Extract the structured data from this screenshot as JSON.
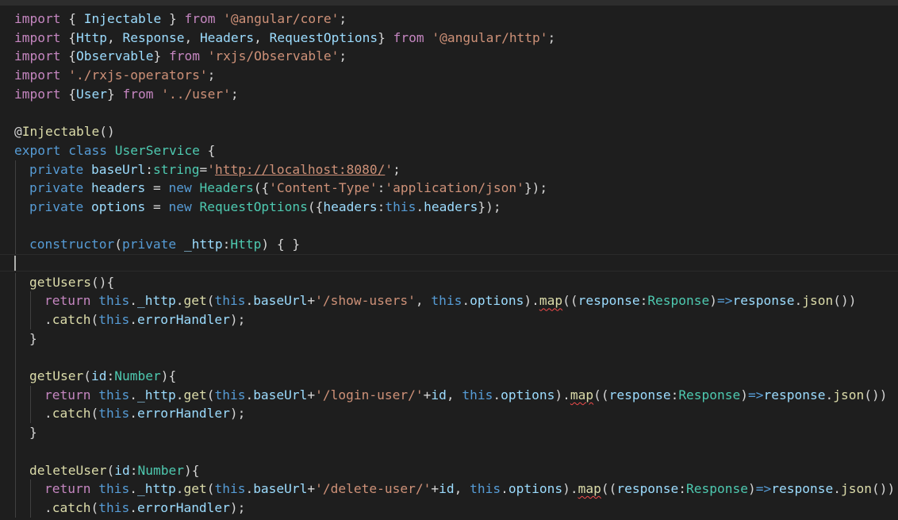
{
  "editor": {
    "language": "typescript",
    "theme_colors": {
      "background": "#1e1e1e",
      "keyword": "#569cd6",
      "control": "#c586c0",
      "type": "#4ec9b0",
      "string": "#ce9178",
      "variable": "#9cdcfe",
      "function": "#dcdcaa",
      "plain": "#d4d4d4",
      "error_squiggle": "#f14c4c"
    },
    "cursor_line": 14,
    "lines": [
      {
        "indent": 0,
        "tokens": [
          [
            "ctl",
            "import"
          ],
          [
            "pl",
            " { "
          ],
          [
            "var",
            "Injectable"
          ],
          [
            "pl",
            " } "
          ],
          [
            "ctl",
            "from"
          ],
          [
            "pl",
            " "
          ],
          [
            "str",
            "'@angular/core'"
          ],
          [
            "pl",
            ";"
          ]
        ]
      },
      {
        "indent": 0,
        "tokens": [
          [
            "ctl",
            "import"
          ],
          [
            "pl",
            " {"
          ],
          [
            "var",
            "Http"
          ],
          [
            "pl",
            ", "
          ],
          [
            "var",
            "Response"
          ],
          [
            "pl",
            ", "
          ],
          [
            "var",
            "Headers"
          ],
          [
            "pl",
            ", "
          ],
          [
            "var",
            "RequestOptions"
          ],
          [
            "pl",
            "} "
          ],
          [
            "ctl",
            "from"
          ],
          [
            "pl",
            " "
          ],
          [
            "str",
            "'@angular/http'"
          ],
          [
            "pl",
            ";"
          ]
        ]
      },
      {
        "indent": 0,
        "tokens": [
          [
            "ctl",
            "import"
          ],
          [
            "pl",
            " {"
          ],
          [
            "var",
            "Observable"
          ],
          [
            "pl",
            "} "
          ],
          [
            "ctl",
            "from"
          ],
          [
            "pl",
            " "
          ],
          [
            "str",
            "'rxjs/Observable'"
          ],
          [
            "pl",
            ";"
          ]
        ]
      },
      {
        "indent": 0,
        "tokens": [
          [
            "ctl",
            "import"
          ],
          [
            "pl",
            " "
          ],
          [
            "str",
            "'./rxjs-operators'"
          ],
          [
            "pl",
            ";"
          ]
        ]
      },
      {
        "indent": 0,
        "tokens": [
          [
            "ctl",
            "import"
          ],
          [
            "pl",
            " {"
          ],
          [
            "var",
            "User"
          ],
          [
            "pl",
            "} "
          ],
          [
            "ctl",
            "from"
          ],
          [
            "pl",
            " "
          ],
          [
            "str",
            "'../user'"
          ],
          [
            "pl",
            ";"
          ]
        ]
      },
      {
        "indent": 0,
        "tokens": []
      },
      {
        "indent": 0,
        "tokens": [
          [
            "pl",
            "@"
          ],
          [
            "fn",
            "Injectable"
          ],
          [
            "pl",
            "()"
          ]
        ]
      },
      {
        "indent": 0,
        "tokens": [
          [
            "kw",
            "export"
          ],
          [
            "pl",
            " "
          ],
          [
            "kw",
            "class"
          ],
          [
            "pl",
            " "
          ],
          [
            "cls",
            "UserService"
          ],
          [
            "pl",
            " {"
          ]
        ]
      },
      {
        "indent": 1,
        "tokens": [
          [
            "kw",
            "private"
          ],
          [
            "pl",
            " "
          ],
          [
            "var",
            "baseUrl"
          ],
          [
            "pl",
            ":"
          ],
          [
            "cls",
            "string"
          ],
          [
            "pl",
            "="
          ],
          [
            "str",
            "'"
          ],
          [
            "str link",
            "http://localhost:8080/"
          ],
          [
            "str",
            "'"
          ],
          [
            "pl",
            ";"
          ]
        ]
      },
      {
        "indent": 1,
        "tokens": [
          [
            "kw",
            "private"
          ],
          [
            "pl",
            " "
          ],
          [
            "var",
            "headers"
          ],
          [
            "pl",
            " = "
          ],
          [
            "kw",
            "new"
          ],
          [
            "pl",
            " "
          ],
          [
            "cls",
            "Headers"
          ],
          [
            "pl",
            "({"
          ],
          [
            "str",
            "'Content-Type'"
          ],
          [
            "pl",
            ":"
          ],
          [
            "str",
            "'application/json'"
          ],
          [
            "pl",
            "});"
          ]
        ]
      },
      {
        "indent": 1,
        "tokens": [
          [
            "kw",
            "private"
          ],
          [
            "pl",
            " "
          ],
          [
            "var",
            "options"
          ],
          [
            "pl",
            " = "
          ],
          [
            "kw",
            "new"
          ],
          [
            "pl",
            " "
          ],
          [
            "cls",
            "RequestOptions"
          ],
          [
            "pl",
            "({"
          ],
          [
            "var",
            "headers"
          ],
          [
            "pl",
            ":"
          ],
          [
            "kw",
            "this"
          ],
          [
            "pl",
            "."
          ],
          [
            "var",
            "headers"
          ],
          [
            "pl",
            "});"
          ]
        ]
      },
      {
        "indent": 1,
        "tokens": []
      },
      {
        "indent": 1,
        "tokens": [
          [
            "kw",
            "constructor"
          ],
          [
            "pl",
            "("
          ],
          [
            "kw",
            "private"
          ],
          [
            "pl",
            " "
          ],
          [
            "var",
            "_http"
          ],
          [
            "pl",
            ":"
          ],
          [
            "cls",
            "Http"
          ],
          [
            "pl",
            ") { }"
          ]
        ]
      },
      {
        "indent": 0,
        "tokens": []
      },
      {
        "indent": 1,
        "tokens": [
          [
            "fn",
            "getUsers"
          ],
          [
            "pl",
            "(){"
          ]
        ]
      },
      {
        "indent": 2,
        "tokens": [
          [
            "ctl",
            "return"
          ],
          [
            "pl",
            " "
          ],
          [
            "kw",
            "this"
          ],
          [
            "pl",
            "."
          ],
          [
            "var",
            "_http"
          ],
          [
            "pl",
            "."
          ],
          [
            "fn",
            "get"
          ],
          [
            "pl",
            "("
          ],
          [
            "kw",
            "this"
          ],
          [
            "pl",
            "."
          ],
          [
            "var",
            "baseUrl"
          ],
          [
            "pl",
            "+"
          ],
          [
            "str",
            "'/show-users'"
          ],
          [
            "pl",
            ", "
          ],
          [
            "kw",
            "this"
          ],
          [
            "pl",
            "."
          ],
          [
            "var",
            "options"
          ],
          [
            "pl",
            ")."
          ],
          [
            "fn squig",
            "map"
          ],
          [
            "pl",
            "(("
          ],
          [
            "var",
            "response"
          ],
          [
            "pl",
            ":"
          ],
          [
            "cls",
            "Response"
          ],
          [
            "pl",
            ")"
          ],
          [
            "kw",
            "=>"
          ],
          [
            "var",
            "response"
          ],
          [
            "pl",
            "."
          ],
          [
            "fn",
            "json"
          ],
          [
            "pl",
            "())"
          ]
        ]
      },
      {
        "indent": 2,
        "tokens": [
          [
            "pl",
            "."
          ],
          [
            "fn",
            "catch"
          ],
          [
            "pl",
            "("
          ],
          [
            "kw",
            "this"
          ],
          [
            "pl",
            "."
          ],
          [
            "var",
            "errorHandler"
          ],
          [
            "pl",
            ");"
          ]
        ]
      },
      {
        "indent": 1,
        "tokens": [
          [
            "pl",
            "}"
          ]
        ]
      },
      {
        "indent": 1,
        "tokens": []
      },
      {
        "indent": 1,
        "tokens": [
          [
            "fn",
            "getUser"
          ],
          [
            "pl",
            "("
          ],
          [
            "var",
            "id"
          ],
          [
            "pl",
            ":"
          ],
          [
            "cls",
            "Number"
          ],
          [
            "pl",
            "){"
          ]
        ]
      },
      {
        "indent": 2,
        "tokens": [
          [
            "ctl",
            "return"
          ],
          [
            "pl",
            " "
          ],
          [
            "kw",
            "this"
          ],
          [
            "pl",
            "."
          ],
          [
            "var",
            "_http"
          ],
          [
            "pl",
            "."
          ],
          [
            "fn",
            "get"
          ],
          [
            "pl",
            "("
          ],
          [
            "kw",
            "this"
          ],
          [
            "pl",
            "."
          ],
          [
            "var",
            "baseUrl"
          ],
          [
            "pl",
            "+"
          ],
          [
            "str",
            "'/login-user/'"
          ],
          [
            "pl",
            "+"
          ],
          [
            "var",
            "id"
          ],
          [
            "pl",
            ", "
          ],
          [
            "kw",
            "this"
          ],
          [
            "pl",
            "."
          ],
          [
            "var",
            "options"
          ],
          [
            "pl",
            ")."
          ],
          [
            "fn squig",
            "map"
          ],
          [
            "pl",
            "(("
          ],
          [
            "var",
            "response"
          ],
          [
            "pl",
            ":"
          ],
          [
            "cls",
            "Response"
          ],
          [
            "pl",
            ")"
          ],
          [
            "kw",
            "=>"
          ],
          [
            "var",
            "response"
          ],
          [
            "pl",
            "."
          ],
          [
            "fn",
            "json"
          ],
          [
            "pl",
            "())"
          ]
        ]
      },
      {
        "indent": 2,
        "tokens": [
          [
            "pl",
            "."
          ],
          [
            "fn",
            "catch"
          ],
          [
            "pl",
            "("
          ],
          [
            "kw",
            "this"
          ],
          [
            "pl",
            "."
          ],
          [
            "var",
            "errorHandler"
          ],
          [
            "pl",
            ");"
          ]
        ]
      },
      {
        "indent": 1,
        "tokens": [
          [
            "pl",
            "}"
          ]
        ]
      },
      {
        "indent": 1,
        "tokens": []
      },
      {
        "indent": 1,
        "tokens": [
          [
            "fn",
            "deleteUser"
          ],
          [
            "pl",
            "("
          ],
          [
            "var",
            "id"
          ],
          [
            "pl",
            ":"
          ],
          [
            "cls",
            "Number"
          ],
          [
            "pl",
            "){"
          ]
        ]
      },
      {
        "indent": 2,
        "tokens": [
          [
            "ctl",
            "return"
          ],
          [
            "pl",
            " "
          ],
          [
            "kw",
            "this"
          ],
          [
            "pl",
            "."
          ],
          [
            "var",
            "_http"
          ],
          [
            "pl",
            "."
          ],
          [
            "fn",
            "get"
          ],
          [
            "pl",
            "("
          ],
          [
            "kw",
            "this"
          ],
          [
            "pl",
            "."
          ],
          [
            "var",
            "baseUrl"
          ],
          [
            "pl",
            "+"
          ],
          [
            "str",
            "'/delete-user/'"
          ],
          [
            "pl",
            "+"
          ],
          [
            "var",
            "id"
          ],
          [
            "pl",
            ", "
          ],
          [
            "kw",
            "this"
          ],
          [
            "pl",
            "."
          ],
          [
            "var",
            "options"
          ],
          [
            "pl",
            ")."
          ],
          [
            "fn squig",
            "map"
          ],
          [
            "pl",
            "(("
          ],
          [
            "var",
            "response"
          ],
          [
            "pl",
            ":"
          ],
          [
            "cls",
            "Response"
          ],
          [
            "pl",
            ")"
          ],
          [
            "kw",
            "=>"
          ],
          [
            "var",
            "response"
          ],
          [
            "pl",
            "."
          ],
          [
            "fn",
            "json"
          ],
          [
            "pl",
            "())"
          ]
        ]
      },
      {
        "indent": 2,
        "tokens": [
          [
            "pl",
            "."
          ],
          [
            "fn",
            "catch"
          ],
          [
            "pl",
            "("
          ],
          [
            "kw",
            "this"
          ],
          [
            "pl",
            "."
          ],
          [
            "var",
            "errorHandler"
          ],
          [
            "pl",
            ");"
          ]
        ]
      }
    ]
  }
}
